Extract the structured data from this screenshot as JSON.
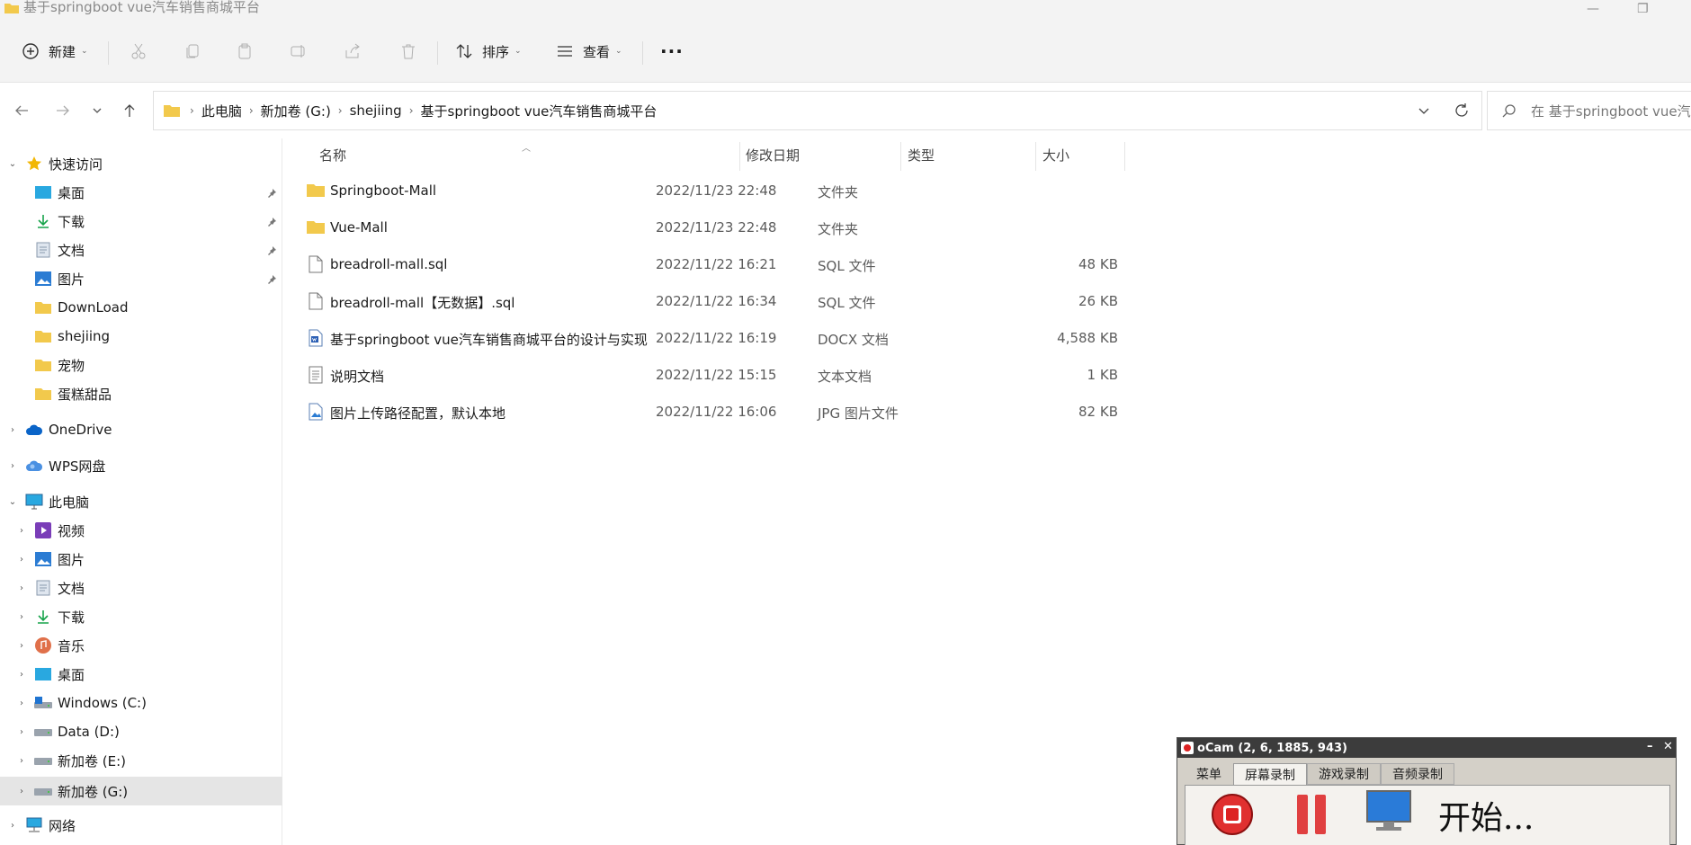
{
  "window": {
    "title": "基于springboot vue汽车销售商城平台"
  },
  "toolbar": {
    "new_label": "新建",
    "sort_label": "排序",
    "view_label": "查看",
    "more_label": "···"
  },
  "address": {
    "crumbs": [
      "此电脑",
      "新加卷 (G:)",
      "shejiing",
      "基于springboot vue汽车销售商城平台"
    ]
  },
  "search": {
    "placeholder": "在 基于springboot vue汽"
  },
  "sidebar": {
    "quick_access": "快速访问",
    "quick_items": [
      {
        "label": "桌面",
        "icon": "desktop-icon",
        "pinned": true
      },
      {
        "label": "下载",
        "icon": "download-icon",
        "pinned": true
      },
      {
        "label": "文档",
        "icon": "document-icon",
        "pinned": true
      },
      {
        "label": "图片",
        "icon": "pictures-icon",
        "pinned": true
      },
      {
        "label": "DownLoad",
        "icon": "folder-icon",
        "pinned": false
      },
      {
        "label": "shejiing",
        "icon": "folder-icon",
        "pinned": false
      },
      {
        "label": "宠物",
        "icon": "folder-icon",
        "pinned": false
      },
      {
        "label": "蛋糕甜品",
        "icon": "folder-icon",
        "pinned": false
      }
    ],
    "onedrive": "OneDrive",
    "wps": "WPS网盘",
    "this_pc": "此电脑",
    "pc_items": [
      {
        "label": "视频",
        "icon": "videos-icon"
      },
      {
        "label": "图片",
        "icon": "pictures-icon"
      },
      {
        "label": "文档",
        "icon": "document-icon"
      },
      {
        "label": "下载",
        "icon": "download-icon"
      },
      {
        "label": "音乐",
        "icon": "music-icon"
      },
      {
        "label": "桌面",
        "icon": "desktop-icon"
      },
      {
        "label": "Windows (C:)",
        "icon": "drive-icon"
      },
      {
        "label": "Data (D:)",
        "icon": "drive-icon"
      },
      {
        "label": "新加卷 (E:)",
        "icon": "drive-icon"
      },
      {
        "label": "新加卷 (G:)",
        "icon": "drive-icon"
      }
    ],
    "network": "网络"
  },
  "columns": {
    "name": "名称",
    "date": "修改日期",
    "type": "类型",
    "size": "大小"
  },
  "files": [
    {
      "name": "Springboot-Mall",
      "date": "2022/11/23 22:48",
      "type": "文件夹",
      "size": "",
      "icon": "folder-icon"
    },
    {
      "name": "Vue-Mall",
      "date": "2022/11/23 22:48",
      "type": "文件夹",
      "size": "",
      "icon": "folder-icon"
    },
    {
      "name": "breadroll-mall.sql",
      "date": "2022/11/22 16:21",
      "type": "SQL 文件",
      "size": "48 KB",
      "icon": "file-icon"
    },
    {
      "name": "breadroll-mall【无数据】.sql",
      "date": "2022/11/22 16:34",
      "type": "SQL 文件",
      "size": "26 KB",
      "icon": "file-icon"
    },
    {
      "name": "基于springboot vue汽车销售商城平台的设计与实现",
      "date": "2022/11/22 16:19",
      "type": "DOCX 文档",
      "size": "4,588 KB",
      "icon": "docx-icon"
    },
    {
      "name": "说明文档",
      "date": "2022/11/22 15:15",
      "type": "文本文档",
      "size": "1 KB",
      "icon": "text-file-icon"
    },
    {
      "name": "图片上传路径配置，默认本地",
      "date": "2022/11/22 16:06",
      "type": "JPG 图片文件",
      "size": "82 KB",
      "icon": "image-file-icon"
    }
  ],
  "ocam": {
    "title": "oCam (2, 6, 1885, 943)",
    "tabs": [
      "菜单",
      "屏幕录制",
      "游戏录制",
      "音频录制"
    ],
    "status": "开始..."
  },
  "colors": {
    "folder": "#f2c94c",
    "accent": "#0067c0",
    "selected_bg": "#e5e5e5"
  }
}
